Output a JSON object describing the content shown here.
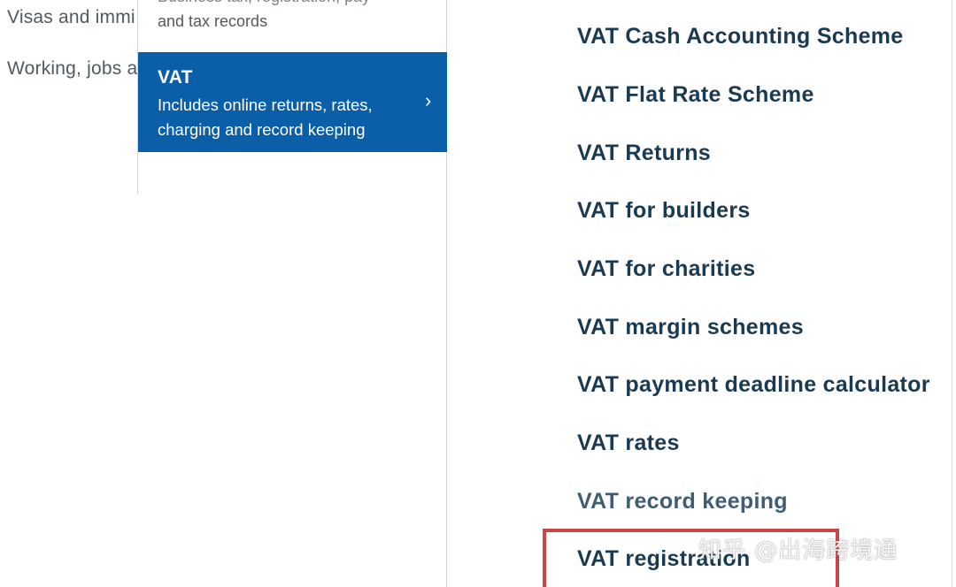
{
  "categories": {
    "items": [
      {
        "label": "Visas and immi"
      },
      {
        "label": "Working, jobs a"
      }
    ]
  },
  "subcategories": {
    "clipped_item": {
      "label_cut": "Business tax, registration, pay",
      "description": "and tax records",
      "chevron": "›"
    },
    "selected": {
      "title": "VAT",
      "description": "Includes online returns, rates, charging and record keeping",
      "chevron": "›",
      "background": "#0b5ea8"
    }
  },
  "vat_links": [
    {
      "label": "VAT Cash Accounting Scheme"
    },
    {
      "label": "VAT Flat Rate Scheme"
    },
    {
      "label": "VAT Returns"
    },
    {
      "label": "VAT for builders"
    },
    {
      "label": "VAT for charities"
    },
    {
      "label": "VAT margin schemes"
    },
    {
      "label": "VAT payment deadline calculator"
    },
    {
      "label": "VAT rates"
    },
    {
      "label": "VAT record keeping"
    },
    {
      "label": "VAT registration"
    }
  ],
  "highlight": {
    "target": "VAT registration",
    "color": "#c8454b"
  },
  "watermark": {
    "text": "知乎 @出海跨境通"
  },
  "colors": {
    "link": "#1a3a52",
    "selected_bg": "#0b5ea8",
    "muted_text": "#505a5f"
  }
}
